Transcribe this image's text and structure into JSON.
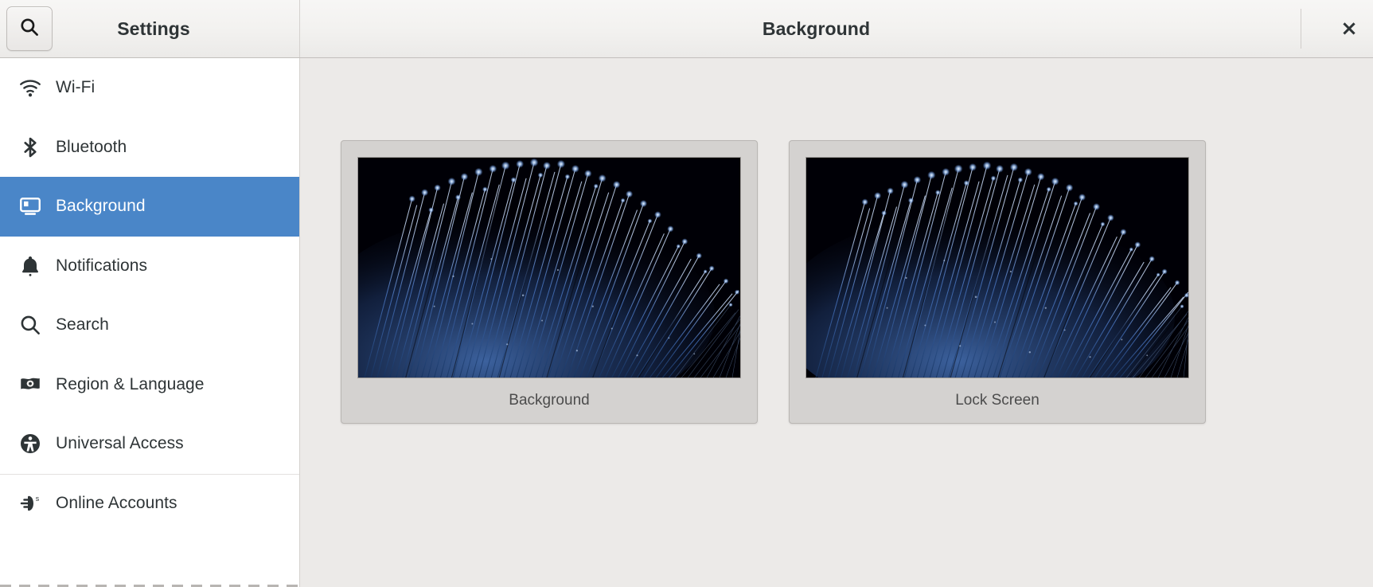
{
  "window": {
    "close_label": "×"
  },
  "header": {
    "left_title": "Settings",
    "right_title": "Background",
    "search_icon": "search-icon",
    "close_icon": "close-icon"
  },
  "sidebar": {
    "items": [
      {
        "label": "Wi-Fi",
        "icon": "wifi-icon",
        "selected": false,
        "separator_above": false
      },
      {
        "label": "Bluetooth",
        "icon": "bluetooth-icon",
        "selected": false,
        "separator_above": false
      },
      {
        "label": "Background",
        "icon": "monitor-icon",
        "selected": true,
        "separator_above": false
      },
      {
        "label": "Notifications",
        "icon": "bell-icon",
        "selected": false,
        "separator_above": false
      },
      {
        "label": "Search",
        "icon": "magnifier-icon",
        "selected": false,
        "separator_above": false
      },
      {
        "label": "Region & Language",
        "icon": "flag-icon",
        "selected": false,
        "separator_above": false
      },
      {
        "label": "Universal Access",
        "icon": "accessibility-icon",
        "selected": false,
        "separator_above": false
      },
      {
        "label": "Online Accounts",
        "icon": "online-accounts-icon",
        "selected": false,
        "separator_above": true
      }
    ]
  },
  "main": {
    "cards": [
      {
        "label": "Background",
        "wallpaper": "fiber-optic-blue"
      },
      {
        "label": "Lock Screen",
        "wallpaper": "fiber-optic-blue"
      }
    ]
  },
  "colors": {
    "selection_blue": "#4a86c8",
    "content_background": "#eceae8",
    "card_background": "#d4d2d0",
    "sidebar_background": "#ffffff",
    "header_background": "#f2f1ef",
    "text_primary": "#2e3436",
    "wallpaper_dark": "#000006",
    "wallpaper_blue": "#3d66a8"
  }
}
